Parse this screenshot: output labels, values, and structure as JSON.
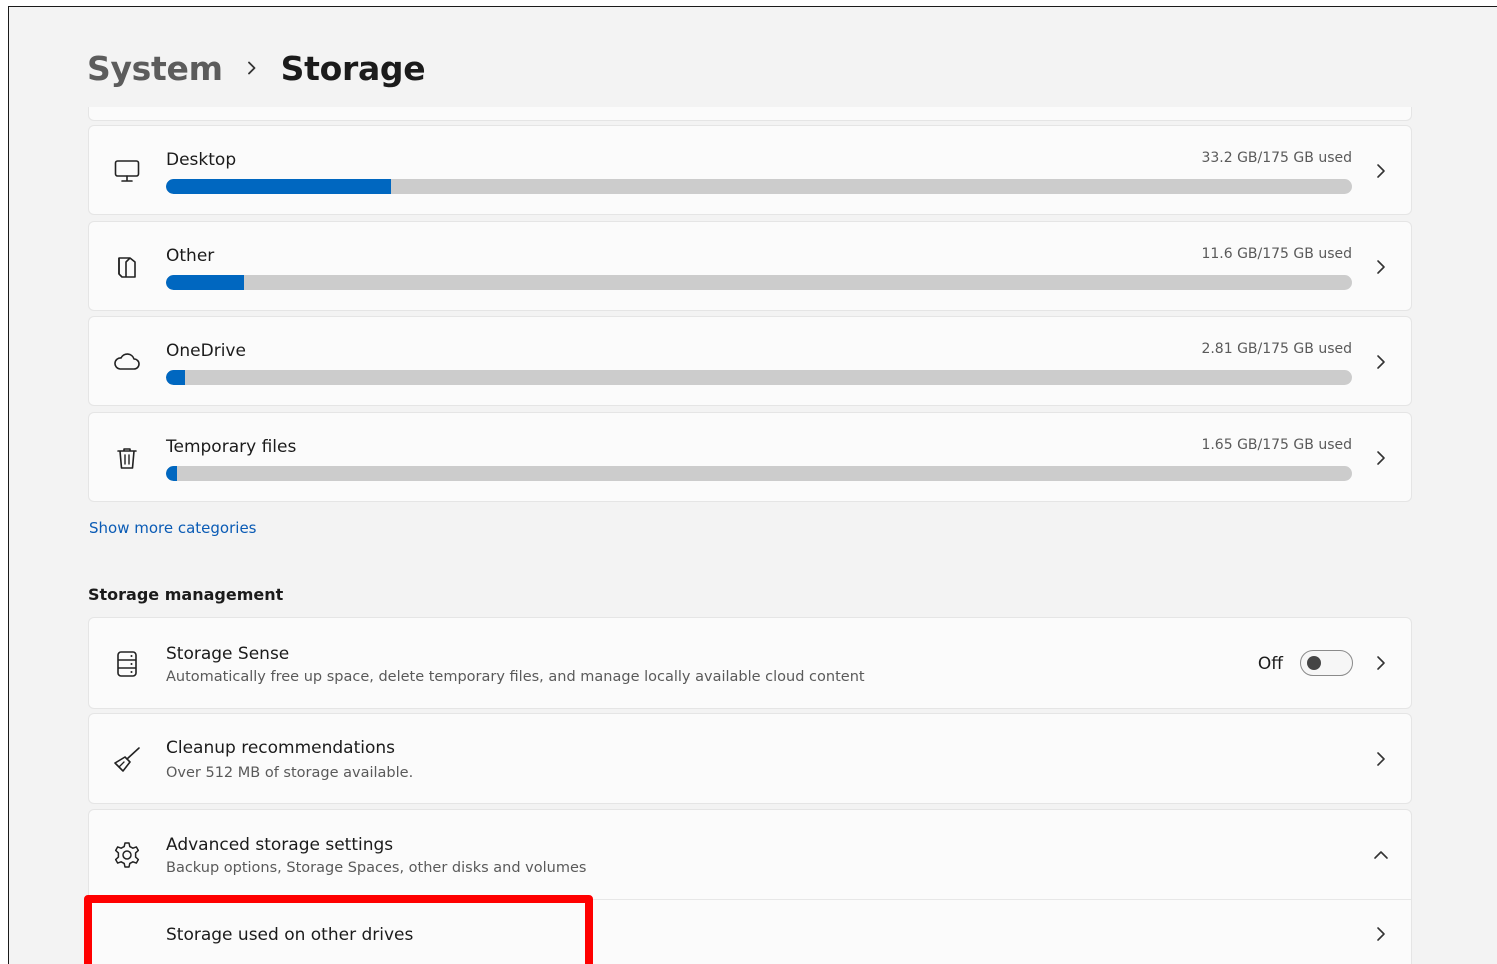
{
  "breadcrumb": {
    "parent": "System",
    "current": "Storage"
  },
  "categories": [
    {
      "name": "Desktop",
      "used": "33.2 GB/175 GB used",
      "fraction": 0.19,
      "icon": "monitor-icon"
    },
    {
      "name": "Other",
      "used": "11.6 GB/175 GB used",
      "fraction": 0.066,
      "icon": "other-files-icon"
    },
    {
      "name": "OneDrive",
      "used": "2.81 GB/175 GB used",
      "fraction": 0.016,
      "icon": "cloud-icon"
    },
    {
      "name": "Temporary files",
      "used": "1.65 GB/175 GB used",
      "fraction": 0.0094,
      "icon": "trash-icon"
    }
  ],
  "show_more_link": "Show more categories",
  "storage_management": {
    "title": "Storage management",
    "storage_sense": {
      "title": "Storage Sense",
      "description": "Automatically free up space, delete temporary files, and manage locally available cloud content",
      "toggle_label": "Off",
      "toggle_on": false
    },
    "cleanup": {
      "title": "Cleanup recommendations",
      "description": "Over 512 MB of storage available."
    },
    "advanced": {
      "title": "Advanced storage settings",
      "description": "Backup options, Storage Spaces, other disks and volumes",
      "expanded": true,
      "children": [
        {
          "label": "Storage used on other drives"
        }
      ]
    }
  },
  "colors": {
    "accent": "#0067c0",
    "bar_track": "#cccccc",
    "highlight": "#ff0000"
  }
}
